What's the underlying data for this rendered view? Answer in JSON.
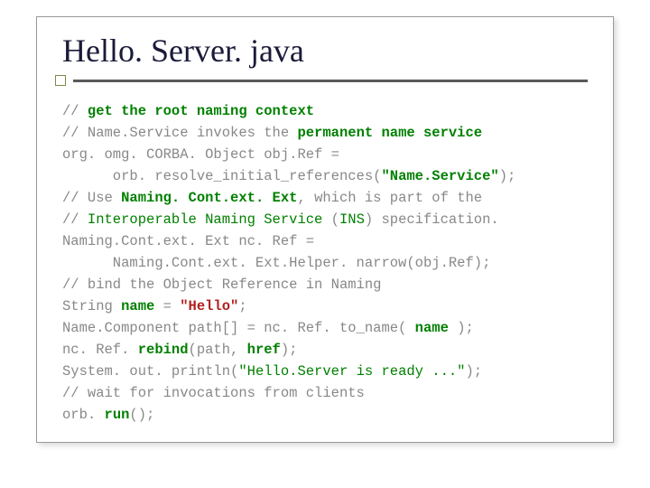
{
  "title": "Hello. Server. java",
  "code": {
    "l1a": "// ",
    "l1b": "get the root naming context",
    "l2a": "// Name.Service invokes the ",
    "l2b": "permanent name service",
    "l3": "org. omg. CORBA. Object obj.Ref =",
    "l4a": "      orb. resolve_initial_references(",
    "l4b": "\"Name.Service\"",
    "l4c": ");",
    "l5a": "// Use ",
    "l5b": "Naming. Cont.ext. Ext",
    "l5c": ", which is part of the",
    "l6a": "// ",
    "l6b": "Interoperable Naming Service",
    "l6c": " (",
    "l6d": "INS",
    "l6e": ") specification.",
    "l7": "Naming.Cont.ext. Ext nc. Ref =",
    "l8": "      Naming.Cont.ext. Ext.Helper. narrow(obj.Ref);",
    "l9": "// bind the Object Reference in Naming",
    "l10a": "String ",
    "l10b": "name",
    "l10c": " = ",
    "l10d": "\"Hello\"",
    "l10e": ";",
    "l11a": "Name.Component path[] = nc. Ref. to_name( ",
    "l11b": "name",
    "l11c": " );",
    "l12a": "nc. Ref. ",
    "l12b": "rebind",
    "l12c": "(path, ",
    "l12d": "href",
    "l12e": ");",
    "l13a": "System. out. println(",
    "l13b": "\"Hello.Server is ready ...\"",
    "l13c": ");",
    "l14": "// wait for invocations from clients",
    "l15a": "orb. ",
    "l15b": "run",
    "l15c": "();"
  }
}
